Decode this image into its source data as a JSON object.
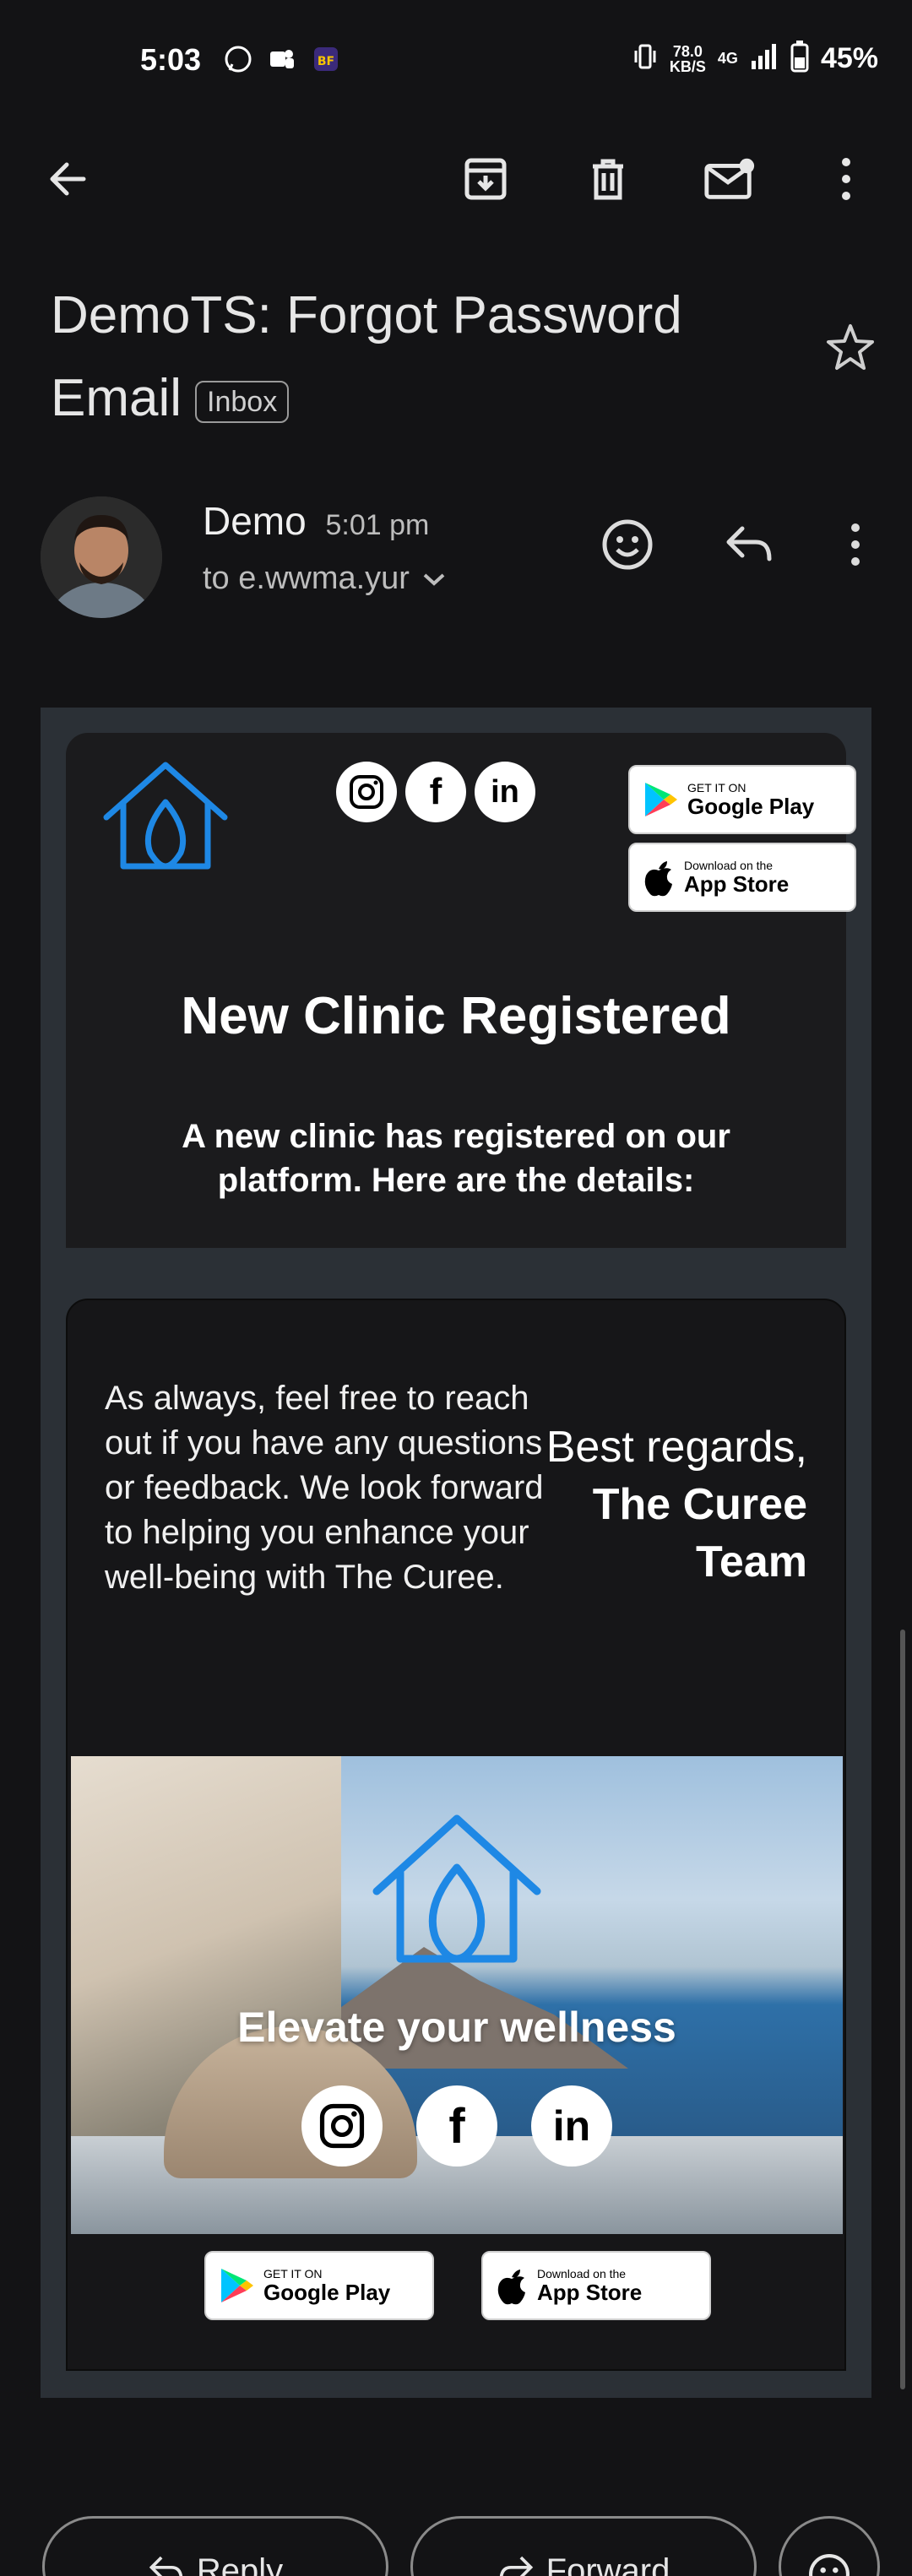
{
  "status_bar": {
    "time": "5:03",
    "speed_value": "78.0",
    "speed_unit": "KB/S",
    "network": "4G",
    "battery": "45%"
  },
  "toolbar": {
    "back_icon": "arrow-left-icon",
    "archive_icon": "archive-icon",
    "delete_icon": "trash-icon",
    "unread_icon": "mark-unread-icon",
    "more_icon": "more-vert-icon"
  },
  "email": {
    "subject_line1": "DemoTS: Forgot Password",
    "subject_line2": "Email",
    "label": "Inbox",
    "sender_name": "Demo",
    "sent_time": "5:01 pm",
    "recipient": "to e.wwma.yur"
  },
  "body": {
    "stores": {
      "google_small": "GET IT ON",
      "google_big": "Google Play",
      "apple_small": "Download on the",
      "apple_big": "App Store"
    },
    "social": {
      "instagram": "instagram-icon",
      "facebook": "f",
      "linkedin": "in"
    },
    "heading": "New Clinic Registered",
    "description": "A new clinic has registered on our platform. Here are the details:",
    "closing": "As always, feel free to reach out if you have any questions or feedback. We look forward to helping you enhance your well-being with The Curee.",
    "regards": "Best regards,",
    "team": "The Curee Team",
    "tagline": "Elevate your wellness"
  },
  "actions": {
    "reply": "Reply",
    "forward": "Forward"
  },
  "colors": {
    "brand_blue": "#1e88e5",
    "background": "#131315",
    "frame": "#2b3036"
  }
}
